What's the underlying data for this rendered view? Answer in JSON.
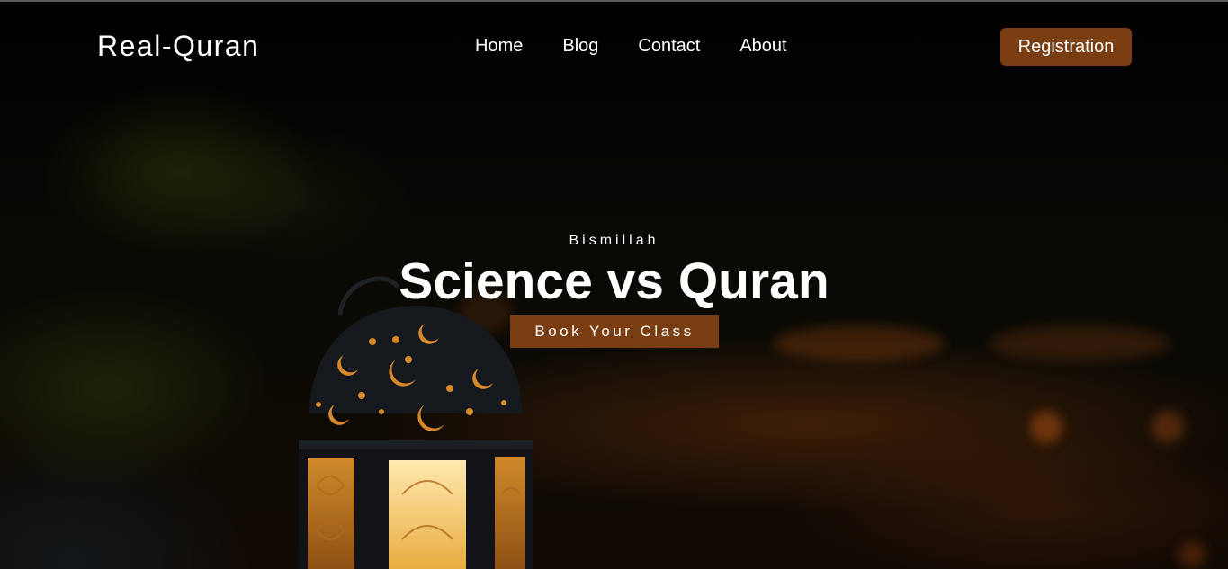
{
  "brand": {
    "name": "Real-Quran"
  },
  "nav": {
    "items": [
      {
        "label": "Home"
      },
      {
        "label": "Blog"
      },
      {
        "label": "Contact"
      },
      {
        "label": "About"
      }
    ],
    "registration_label": "Registration"
  },
  "hero": {
    "kicker": "Bismillah",
    "title": "Science vs Quran",
    "cta_label": "Book Your Class",
    "background_subject": "lantern-photo"
  },
  "colors": {
    "accent": "#7a3d12",
    "background": "#000000",
    "text": "#ffffff"
  }
}
